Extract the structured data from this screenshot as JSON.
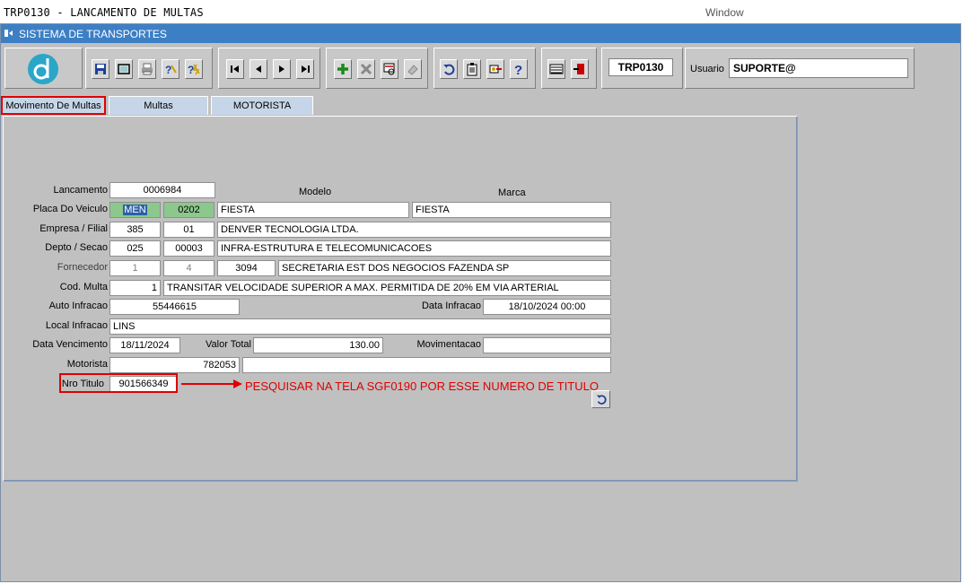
{
  "window": {
    "title": "TRP0130 - LANCAMENTO DE MULTAS",
    "menu_window": "Window"
  },
  "system": {
    "title": "SISTEMA DE TRANSPORTES"
  },
  "toolbar": {
    "form_code": "TRP0130",
    "user_label": "Usuario",
    "user_value": "SUPORTE@"
  },
  "tabs": [
    {
      "label": "Movimento De Multas",
      "active": true
    },
    {
      "label": "Multas",
      "active": false
    },
    {
      "label": "MOTORISTA",
      "active": false
    }
  ],
  "form": {
    "lancamento": {
      "label": "Lancamento",
      "value": "0006984"
    },
    "headers": {
      "modelo": "Modelo",
      "marca": "Marca"
    },
    "placa": {
      "label": "Placa Do Veiculo",
      "letters": "MEN",
      "numbers": "0202",
      "modelo": "FIESTA",
      "marca": "FIESTA"
    },
    "empresa": {
      "label": "Empresa / Filial",
      "empresa": "385",
      "filial": "01",
      "nome": "DENVER TECNOLOGIA LTDA."
    },
    "depto": {
      "label": "Depto / Secao",
      "depto": "025",
      "secao": "00003",
      "nome": "INFRA-ESTRUTURA E TELECOMUNICACOES"
    },
    "fornecedor": {
      "label": "Fornecedor",
      "f1": "1",
      "f2": "4",
      "codigo": "3094",
      "nome": "SECRETARIA EST DOS NEGOCIOS FAZENDA SP"
    },
    "cod_multa": {
      "label": "Cod. Multa",
      "codigo": "1",
      "descricao": "TRANSITAR VELOCIDADE SUPERIOR A MAX. PERMITIDA DE 20% EM VIA ARTERIAL"
    },
    "auto_infracao": {
      "label": "Auto Infracao",
      "value": "55446615"
    },
    "data_infracao": {
      "label": "Data Infracao",
      "value": "18/10/2024 00:00"
    },
    "local_infracao": {
      "label": "Local Infracao",
      "value": "LINS"
    },
    "data_vencimento": {
      "label": "Data Vencimento",
      "value": "18/11/2024"
    },
    "valor_total": {
      "label": "Valor Total",
      "value": "130.00"
    },
    "movimentacao": {
      "label": "Movimentacao",
      "value": ""
    },
    "motorista": {
      "label": "Motorista",
      "codigo": "782053",
      "nome": ""
    },
    "nro_titulo": {
      "label": "Nro Titulo",
      "value": "901566349"
    }
  },
  "annotation": {
    "text": "PESQUISAR NA TELA SGF0190 POR ESSE NUMERO DE TITULO"
  },
  "colors": {
    "accent": "#3d7fc4",
    "highlight": "#e00000",
    "green_field": "#8cc88c"
  }
}
